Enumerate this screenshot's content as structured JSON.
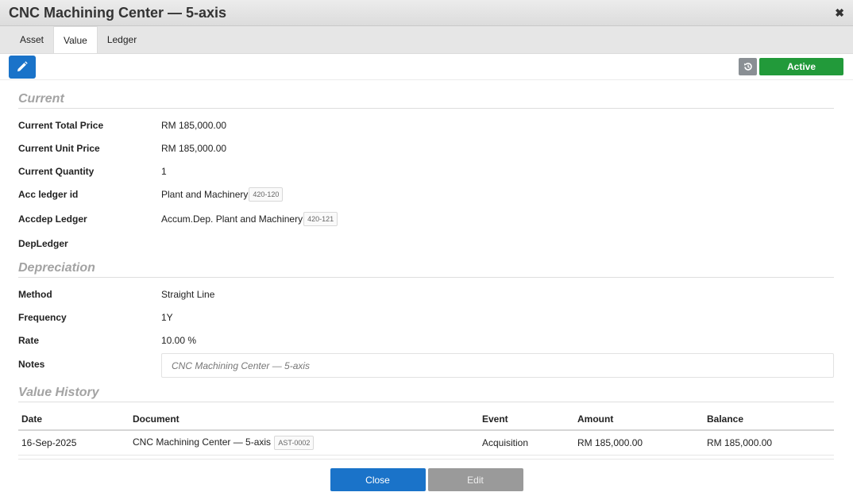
{
  "window": {
    "title": "CNC Machining Center — 5-axis",
    "close_glyph": "✖"
  },
  "tabs": [
    {
      "label": "Asset"
    },
    {
      "label": "Value"
    },
    {
      "label": "Ledger"
    }
  ],
  "toolbar": {
    "status": "Active"
  },
  "current": {
    "heading": "Current",
    "total_price": {
      "label": "Current Total Price",
      "value": "RM 185,000.00"
    },
    "unit_price": {
      "label": "Current Unit Price",
      "value": "RM 185,000.00"
    },
    "quantity": {
      "label": "Current Quantity",
      "value": "1"
    },
    "acc_ledger": {
      "label": "Acc ledger id",
      "value": "Plant and Machinery",
      "code": "420-120"
    },
    "accdep_ledger": {
      "label": "Accdep Ledger",
      "value": "Accum.Dep. Plant and Machinery",
      "code": "420-121"
    },
    "dep_ledger": {
      "label": "DepLedger",
      "value": ""
    }
  },
  "depreciation": {
    "heading": "Depreciation",
    "method": {
      "label": "Method",
      "value": "Straight Line"
    },
    "frequency": {
      "label": "Frequency",
      "value": "1Y"
    },
    "rate": {
      "label": "Rate",
      "value": "10.00 %"
    },
    "notes": {
      "label": "Notes",
      "value": "CNC Machining Center — 5-axis"
    }
  },
  "history": {
    "heading": "Value History",
    "columns": {
      "date": "Date",
      "document": "Document",
      "event": "Event",
      "amount": "Amount",
      "balance": "Balance"
    },
    "rows": [
      {
        "date": "16-Sep-2025",
        "document": "CNC Machining Center — 5-axis",
        "doc_code": "AST-0002",
        "event": "Acquisition",
        "amount": "RM 185,000.00",
        "balance": "RM 185,000.00"
      }
    ]
  },
  "footer": {
    "close_label": "Close",
    "edit_label": "Edit"
  },
  "colors": {
    "primary": "#1a73c9",
    "active": "#229a3a",
    "disabled": "#9a9a9a"
  }
}
